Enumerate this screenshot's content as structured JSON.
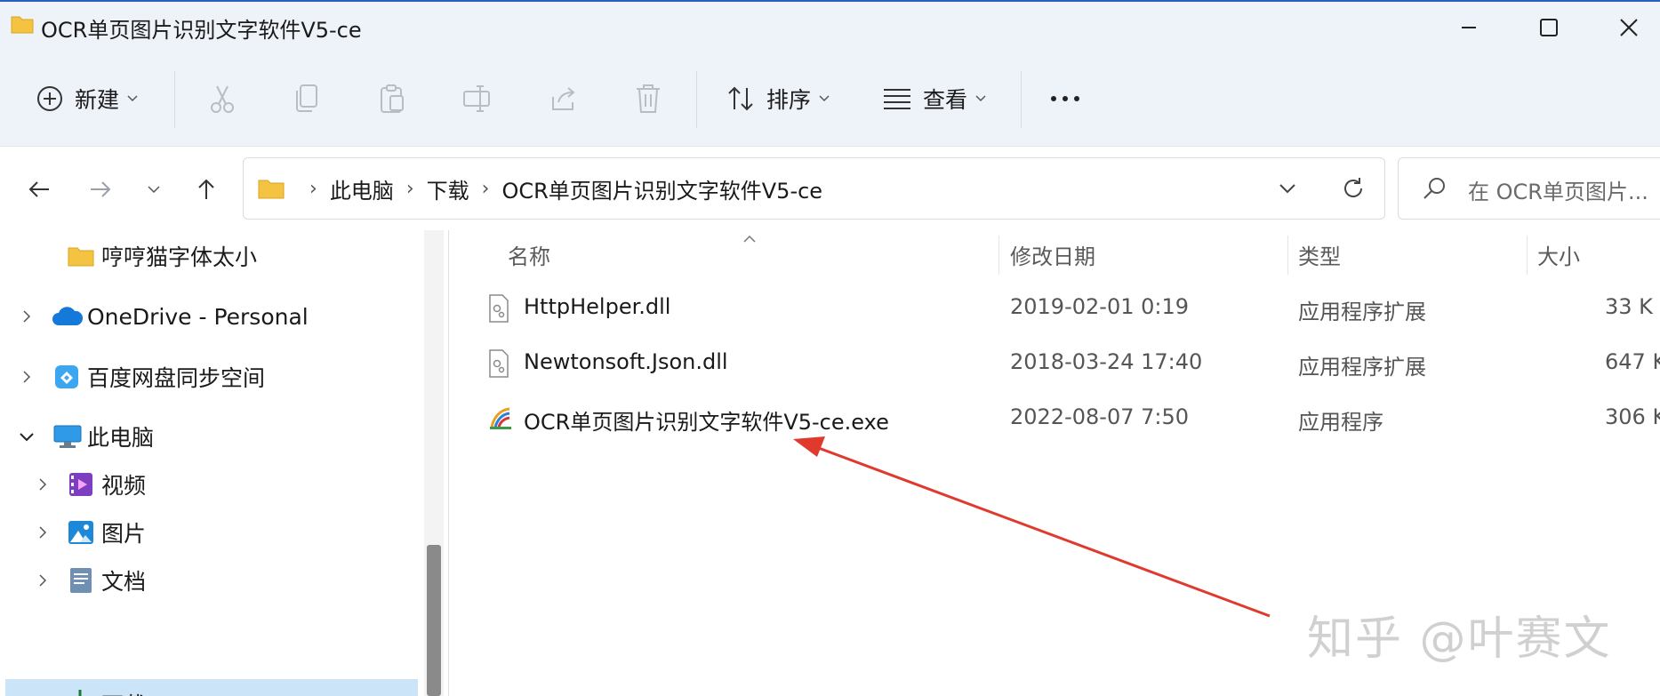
{
  "window": {
    "title": "OCR单页图片识别文字软件V5-ce"
  },
  "toolbar": {
    "new_label": "新建",
    "sort_label": "排序",
    "view_label": "查看",
    "more_label": "•••"
  },
  "address": {
    "crumbs": [
      "此电脑",
      "下载",
      "OCR单页图片识别文字软件V5-ce"
    ],
    "separator": "›"
  },
  "search": {
    "placeholder": "在 OCR单页图片..."
  },
  "sidebar": {
    "items": [
      {
        "label": "哼哼猫字体太小",
        "icon": "folder-icon"
      },
      {
        "label": "OneDrive - Personal",
        "icon": "onedrive-icon"
      },
      {
        "label": "百度网盘同步空间",
        "icon": "baidu-netdisk-icon"
      },
      {
        "label": "此电脑",
        "icon": "computer-icon"
      },
      {
        "label": "视频",
        "icon": "video-icon"
      },
      {
        "label": "图片",
        "icon": "pictures-icon"
      },
      {
        "label": "文档",
        "icon": "documents-icon"
      },
      {
        "label": "下载",
        "icon": "downloads-icon"
      }
    ]
  },
  "filelist": {
    "columns": [
      "名称",
      "修改日期",
      "类型",
      "大小"
    ],
    "rows": [
      {
        "name": "HttpHelper.dll",
        "date": "2019-02-01 0:19",
        "type": "应用程序扩展",
        "size": "33 K",
        "icon": "dll-file-icon"
      },
      {
        "name": "Newtonsoft.Json.dll",
        "date": "2018-03-24 17:40",
        "type": "应用程序扩展",
        "size": "647 K",
        "icon": "dll-file-icon"
      },
      {
        "name": "OCR单页图片识别文字软件V5-ce.exe",
        "date": "2022-08-07 7:50",
        "type": "应用程序",
        "size": "306 K",
        "icon": "exe-app-icon"
      }
    ]
  },
  "watermark": "知乎 @叶赛文",
  "colors": {
    "chrome_bg": "#eef2f9",
    "selection": "#cce4f7",
    "annotation_arrow": "#e03a2f",
    "folder": "#f4c342"
  }
}
